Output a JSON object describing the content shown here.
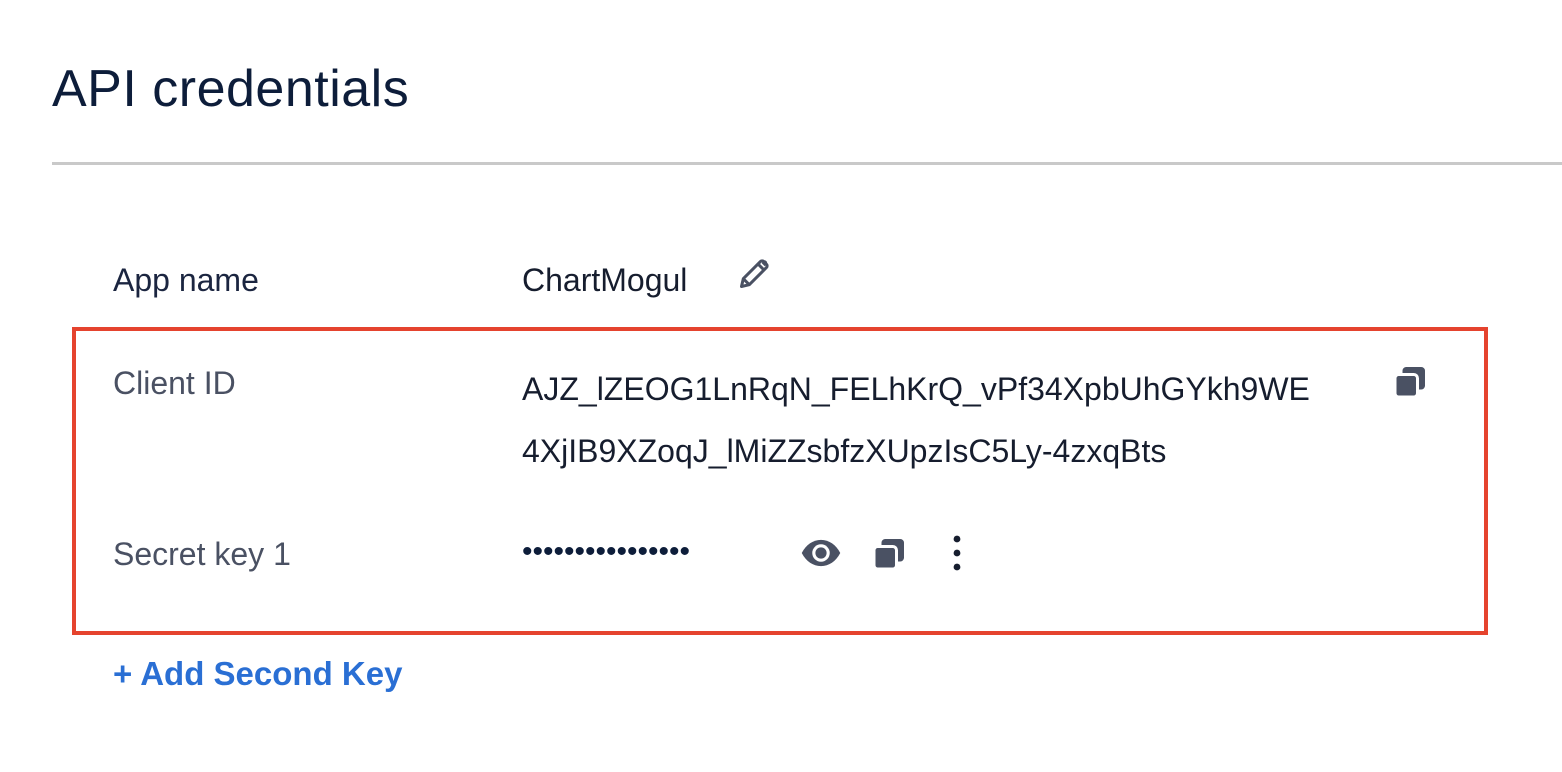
{
  "section": {
    "title": "API credentials"
  },
  "app": {
    "label": "App name",
    "value": "ChartMogul",
    "edit_icon": "pencil-icon"
  },
  "client_id": {
    "label": "Client ID",
    "value_line1": "AJZ_lZEOG1LnRqN_FELhKrQ_vPf34XpbUhGYkh9WE",
    "value_line2": "4XjIB9XZoqJ_lMiZZsbfzXUpzIsC5Ly-4zxqBts",
    "copy_icon": "copy-icon"
  },
  "secret_key": {
    "label": "Secret key 1",
    "masked_value": "••••••••••••••••",
    "reveal_icon": "eye-icon",
    "copy_icon": "copy-icon",
    "more_icon": "more-vertical-icon"
  },
  "actions": {
    "add_second_key": "+ Add Second Key"
  },
  "colors": {
    "title": "#0d1d3a",
    "highlight_border": "#e5432e",
    "link": "#2a6fd4",
    "icon": "#4a5163",
    "divider": "#c9c9c9"
  }
}
